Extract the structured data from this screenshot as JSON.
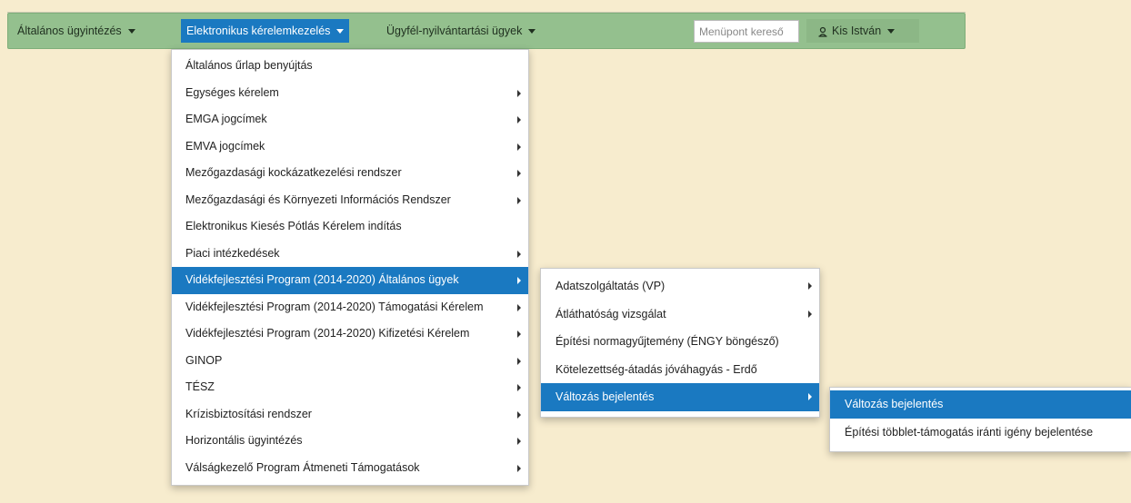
{
  "nav": {
    "items": [
      {
        "label": "Általános ügyintézés"
      },
      {
        "label": "Elektronikus kérelemkezelés"
      },
      {
        "label": "Ügyfél-nyilvántartási ügyek"
      }
    ],
    "search_placeholder": "Menüpont kereső",
    "user_label": "Kis István"
  },
  "menu1": {
    "items": [
      {
        "label": "Általános űrlap benyújtás",
        "submenu": false
      },
      {
        "label": "Egységes kérelem",
        "submenu": true
      },
      {
        "label": "EMGA jogcímek",
        "submenu": true
      },
      {
        "label": "EMVA jogcímek",
        "submenu": true
      },
      {
        "label": "Mezőgazdasági kockázatkezelési rendszer",
        "submenu": true
      },
      {
        "label": "Mezőgazdasági és Környezeti Információs Rendszer",
        "submenu": true
      },
      {
        "label": "Elektronikus Kiesés Pótlás Kérelem indítás",
        "submenu": false
      },
      {
        "label": "Piaci intézkedések",
        "submenu": true
      },
      {
        "label": "Vidékfejlesztési Program (2014-2020) Általános ügyek",
        "submenu": true,
        "highlighted": true
      },
      {
        "label": "Vidékfejlesztési Program (2014-2020) Támogatási Kérelem",
        "submenu": true
      },
      {
        "label": "Vidékfejlesztési Program (2014-2020) Kifizetési Kérelem",
        "submenu": true
      },
      {
        "label": "GINOP",
        "submenu": true
      },
      {
        "label": "TÉSZ",
        "submenu": true
      },
      {
        "label": "Krízisbiztosítási rendszer",
        "submenu": true
      },
      {
        "label": "Horizontális ügyintézés",
        "submenu": true
      },
      {
        "label": "Válságkezelő Program Átmeneti Támogatások",
        "submenu": true
      }
    ]
  },
  "menu2": {
    "items": [
      {
        "label": "Adatszolgáltatás (VP)",
        "submenu": true
      },
      {
        "label": "Átláthatóság vizsgálat",
        "submenu": true
      },
      {
        "label": "Építési normagyűjtemény (ÉNGY böngésző)",
        "submenu": false
      },
      {
        "label": "Kötelezettség-átadás jóváhagyás - Erdő",
        "submenu": false
      },
      {
        "label": "Változás bejelentés",
        "submenu": true,
        "highlighted": true
      }
    ]
  },
  "menu3": {
    "items": [
      {
        "label": "Változás bejelentés",
        "highlighted": true
      },
      {
        "label": "Építési többlet-támogatás iránti igény bejelentése"
      }
    ]
  },
  "colors": {
    "background": "#f7ecce",
    "navbar": "#94c08e",
    "highlight": "#1a79c1"
  }
}
